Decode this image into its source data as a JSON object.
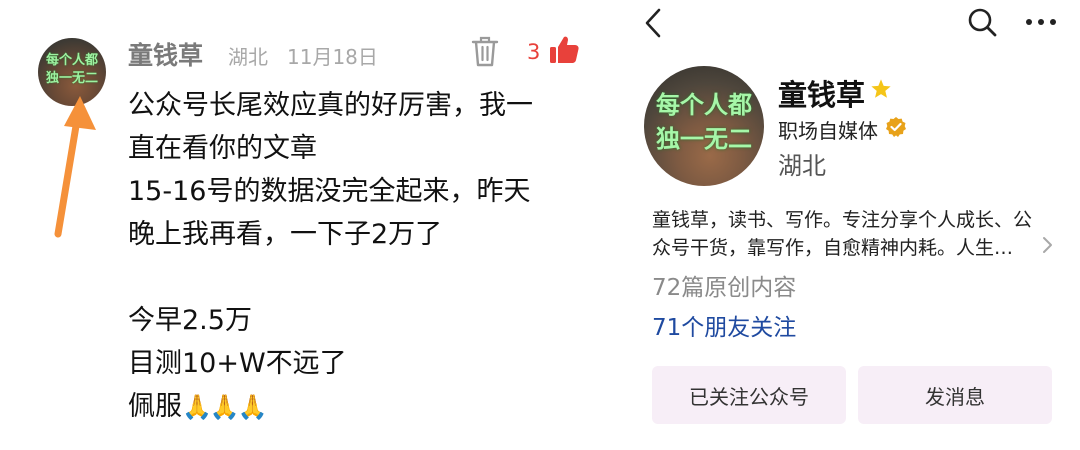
{
  "comment": {
    "avatar_text": [
      "每个人都",
      "独一无二"
    ],
    "author": "童钱草",
    "location": "湖北",
    "date": "11月18日",
    "like_count": "3",
    "lines": [
      "公众号长尾效应真的好厉害，我一",
      "直在看你的文章",
      "15-16号的数据没完全起来，昨天",
      "晚上我再看，一下子2万了",
      "",
      "今早2.5万",
      "目测10+W不远了",
      "佩服"
    ],
    "emoji": "🙏🙏🙏",
    "colors": {
      "like": "#e8413b",
      "arrow": "#f5913a",
      "meta": "#a8a8a8"
    }
  },
  "profile": {
    "avatar_text": [
      "每个人都",
      "独一无二"
    ],
    "name": "童钱草",
    "role": "职场自媒体",
    "location": "湖北",
    "bio_lines": [
      "童钱草，读书、写作。专注分享个人成长、公",
      "众号干货，靠写作，自愈精神内耗。人生…"
    ],
    "article_count": "72篇原创内容",
    "friends_following": "71个朋友关注",
    "buttons": {
      "follow": "已关注公众号",
      "message": "发消息"
    },
    "colors": {
      "star": "#f5c518",
      "verify": "#e8a21a",
      "friends": "#1f4aa0",
      "button_bg": "#f7eef7"
    }
  },
  "icons": [
    "back-icon",
    "search-icon",
    "more-icon",
    "trash-icon",
    "thumbs-up-icon",
    "star-icon",
    "verified-icon",
    "chevron-right-icon",
    "arrow-annotation"
  ]
}
